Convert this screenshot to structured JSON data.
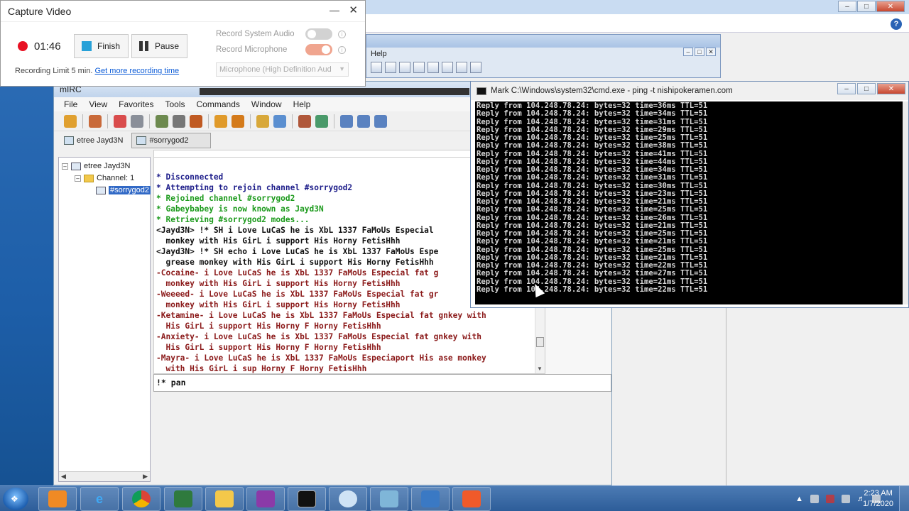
{
  "capture": {
    "title": "Capture Video",
    "minimize": "—",
    "close": "✕",
    "time": "01:46",
    "finish": "Finish",
    "pause": "Pause",
    "limit_text": "Recording Limit 5 min.",
    "limit_link": "Get more recording time",
    "record_system_audio": "Record System Audio",
    "record_microphone": "Record Microphone",
    "mic_select": "Microphone (High Definition Aud",
    "system_audio_on": false,
    "microphone_on": true,
    "rec_color": "#e81123"
  },
  "bg": {
    "help": "?",
    "mid_menu": "Help"
  },
  "mirc": {
    "title": "mIRC",
    "menu": [
      "File",
      "View",
      "Favorites",
      "Tools",
      "Commands",
      "Window",
      "Help"
    ],
    "switchbar": [
      {
        "label": "etree Jayd3N",
        "active": false
      },
      {
        "label": "#sorrygod2",
        "active": true
      }
    ],
    "tree": {
      "server": "etree Jayd3N",
      "channel_group": "Channel: 1",
      "channel": "#sorrygod2"
    },
    "chat": [
      {
        "cls": "c-blue",
        "text": "* Disconnected"
      },
      {
        "cls": "c-blue",
        "text": "* Attempting to rejoin channel #sorrygod2"
      },
      {
        "cls": "c-green",
        "text": "* Rejoined channel #sorrygod2"
      },
      {
        "cls": "c-green",
        "text": "* Gabeybabey is now known as Jayd3N"
      },
      {
        "cls": "c-green",
        "text": "* Retrieving #sorrygod2 modes..."
      },
      {
        "cls": "c-black",
        "text": "<Jayd3N> !* SH i Love LuCaS he is XbL 1337 FaMoUs Especial"
      },
      {
        "cls": "c-black",
        "text": "  monkey with His GirL i support His Horny FetisHhh"
      },
      {
        "cls": "c-black",
        "text": "<Jayd3N> !* SH echo i Love LuCaS he is XbL 1337 FaMoUs Espe"
      },
      {
        "cls": "c-black",
        "text": "  grease monkey with His GirL i support His Horny FetisHhh"
      },
      {
        "cls": "c-red",
        "text": "-Cocaine- i Love LuCaS he is XbL 1337 FaMoUs Especial fat g"
      },
      {
        "cls": "c-red",
        "text": "  monkey with His GirL i support His Horny FetisHhh"
      },
      {
        "cls": "c-red",
        "text": "-Weeeed- i Love LuCaS he is XbL 1337 FaMoUs Especial fat gr"
      },
      {
        "cls": "c-red",
        "text": "  monkey with His GirL i support His Horny FetisHhh"
      },
      {
        "cls": "c-red",
        "text": "-Ketamine- i Love LuCaS he is XbL 1337 FaMoUs Especial fat gnkey with"
      },
      {
        "cls": "c-red",
        "text": "  His GirL i support His Horny F Horny FetisHhh"
      },
      {
        "cls": "c-red",
        "text": "-Anxiety- i Love LuCaS he is XbL 1337 FaMoUs Especial fat gnkey with"
      },
      {
        "cls": "c-red",
        "text": "  His GirL i support His Horny F Horny FetisHhh"
      },
      {
        "cls": "c-red",
        "text": "-Mayra- i Love LuCaS he is XbL 1337 FaMoUs Especiaport His ase monkey"
      },
      {
        "cls": "c-red",
        "text": "  with His GirL i sup Horny F Horny FetisHhh"
      }
    ],
    "input": "!* pan"
  },
  "cmd": {
    "title": "Mark C:\\Windows\\system32\\cmd.exe - ping  -t nishipokeramen.com",
    "host": "104.248.78.24",
    "bytes": 32,
    "ttl": 51,
    "times": [
      36,
      34,
      31,
      29,
      25,
      38,
      41,
      44,
      34,
      31,
      30,
      23,
      21,
      25,
      26,
      21,
      25,
      21,
      25,
      21,
      22,
      27,
      21,
      22
    ]
  },
  "taskbar": {
    "apps": [
      "media-player",
      "internet-explorer",
      "chrome",
      "task-manager",
      "file-explorer",
      "winrar",
      "cmd",
      "snipping-tool",
      "notepad",
      "remote-desktop",
      "recorder"
    ],
    "clock_time": "2:23 AM",
    "clock_date": "1/7/2020"
  }
}
